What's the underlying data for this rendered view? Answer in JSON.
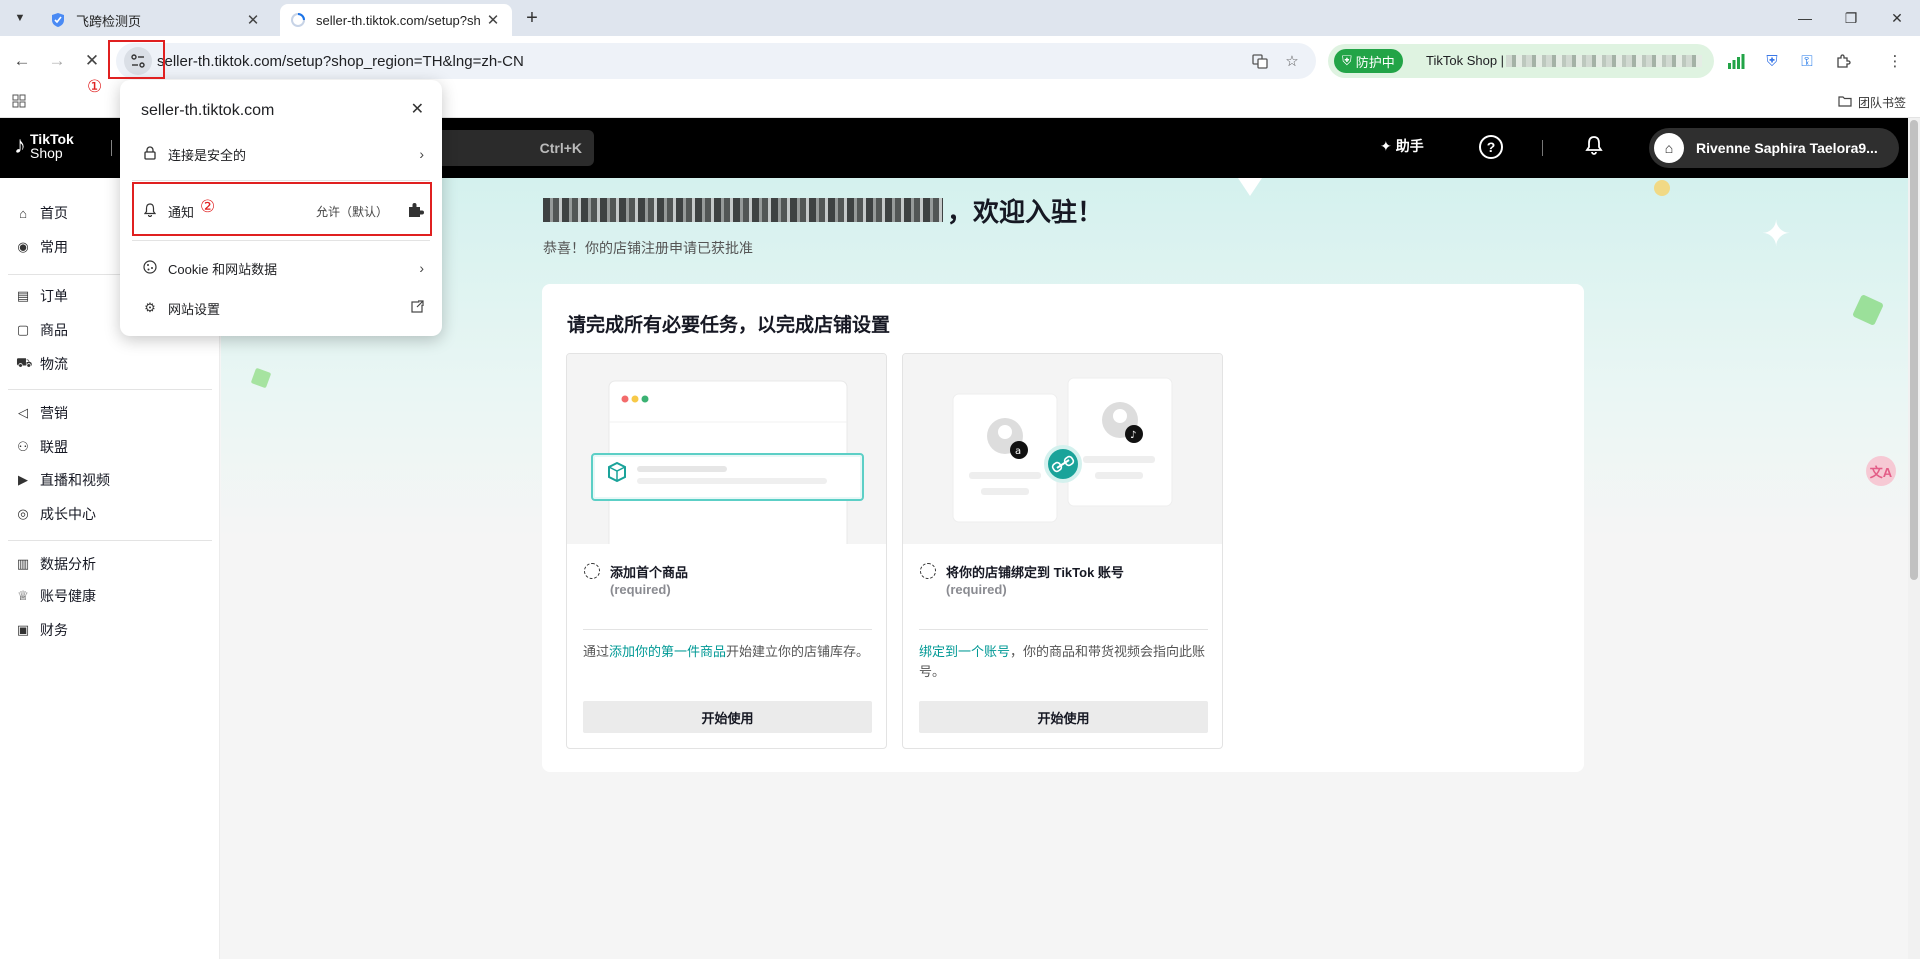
{
  "browser": {
    "tabs": [
      {
        "title": "飞跨检测页",
        "active": false
      },
      {
        "title": "seller-th.tiktok.com/setup?sh",
        "active": true
      }
    ],
    "url": "seller-th.tiktok.com/setup?shop_region=TH&lng=zh-CN",
    "extension": {
      "badge": "防护中",
      "text": "TikTok Shop |"
    },
    "bookmark_folder": "团队书签"
  },
  "site_popup": {
    "domain": "seller-th.tiktok.com",
    "rows": {
      "security": "连接是安全的",
      "notifications": "通知",
      "notifications_value": "允许（默认）",
      "cookies": "Cookie 和网站数据",
      "site_settings": "网站设置"
    }
  },
  "annotations": {
    "marker1": "①",
    "marker2": "②"
  },
  "header": {
    "logo_line1": "TikTok",
    "logo_line2": "Shop",
    "search_shortcut": "Ctrl+K",
    "assistant_label": "助手",
    "user_name": "Rivenne Saphira Taelora9..."
  },
  "sidebar": {
    "groups": [
      [
        {
          "label": "首页",
          "icon": "home-icon"
        },
        {
          "label": "常用",
          "icon": "frequent-icon"
        }
      ],
      [
        {
          "label": "订单",
          "icon": "order-icon"
        },
        {
          "label": "商品",
          "icon": "product-icon"
        },
        {
          "label": "物流",
          "icon": "logistics-icon"
        }
      ],
      [
        {
          "label": "营销",
          "icon": "marketing-icon"
        },
        {
          "label": "联盟",
          "icon": "affiliate-icon"
        },
        {
          "label": "直播和视频",
          "icon": "live-video-icon"
        },
        {
          "label": "成长中心",
          "icon": "growth-icon"
        }
      ],
      [
        {
          "label": "数据分析",
          "icon": "analytics-icon"
        },
        {
          "label": "账号健康",
          "icon": "account-health-icon"
        },
        {
          "label": "财务",
          "icon": "finance-icon"
        }
      ]
    ]
  },
  "main": {
    "welcome_suffix": "，欢迎入驻！",
    "subtitle": "恭喜！你的店铺注册申请已获批准",
    "card_title": "请完成所有必要任务，以完成店铺设置",
    "tasks": [
      {
        "name": "添加首个商品",
        "required": "(required)",
        "desc_prefix": "通过",
        "desc_link": "添加你的第一件商品",
        "desc_suffix": "开始建立你的店铺库存。",
        "button": "开始使用"
      },
      {
        "name": "将你的店铺绑定到 TikTok 账号",
        "required": "(required)",
        "desc_prefix": "",
        "desc_link": "绑定到一个账号",
        "desc_suffix": "，你的商品和带货视频会指向此账号。",
        "button": "开始使用"
      }
    ]
  },
  "colors": {
    "accent": "#009995",
    "annotation_red": "#e02020",
    "shield_green": "#22a447"
  }
}
